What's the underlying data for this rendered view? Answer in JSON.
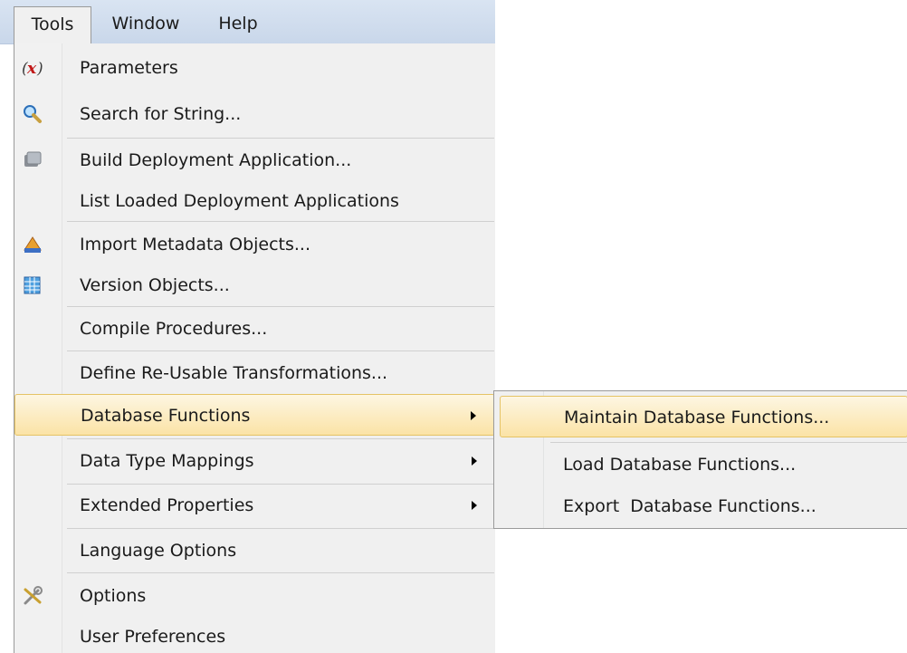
{
  "menubar": {
    "items": [
      {
        "label": "Tools"
      },
      {
        "label": "Window"
      },
      {
        "label": "Help"
      }
    ]
  },
  "tools_menu": {
    "items": [
      {
        "label": "Parameters",
        "icon": "parameters-icon"
      },
      {
        "label": "Search for String...",
        "icon": "search-icon"
      },
      {
        "label": "Build Deployment Application...",
        "icon": "deployment-icon"
      },
      {
        "label": "List Loaded Deployment Applications",
        "icon": ""
      },
      {
        "label": "Import Metadata Objects...",
        "icon": "import-icon"
      },
      {
        "label": "Version Objects...",
        "icon": "version-grid-icon"
      },
      {
        "label": "Compile Procedures...",
        "icon": ""
      },
      {
        "label": "Define Re-Usable Transformations...",
        "icon": ""
      },
      {
        "label": "Database Functions",
        "icon": "",
        "has_submenu": true,
        "highlighted": true
      },
      {
        "label": "Data Type Mappings",
        "icon": "",
        "has_submenu": true
      },
      {
        "label": "Extended Properties",
        "icon": "",
        "has_submenu": true
      },
      {
        "label": "Language Options",
        "icon": ""
      },
      {
        "label": "Options",
        "icon": "options-tools-icon"
      },
      {
        "label": "User Preferences",
        "icon": ""
      }
    ]
  },
  "database_functions_submenu": {
    "items": [
      {
        "label": "Maintain Database Functions...",
        "highlighted": true
      },
      {
        "label": "Load Database Functions..."
      },
      {
        "label": "Export  Database Functions..."
      }
    ]
  },
  "colors": {
    "menubar_bg": "#cfdcee",
    "menu_bg": "#f0f0f0",
    "highlight_bg": "#fbe3a6",
    "highlight_border": "#e5c365",
    "separator": "#d0d0d0",
    "text": "#1a1a1a"
  }
}
